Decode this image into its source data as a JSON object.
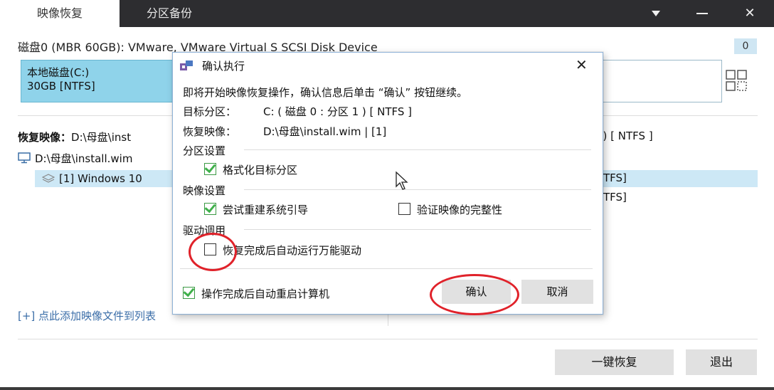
{
  "titlebar": {
    "tabs": [
      {
        "label": "映像恢复",
        "active": true
      },
      {
        "label": "分区备份",
        "active": false
      }
    ],
    "close_symbol": "✕"
  },
  "main": {
    "disk_title": "磁盘0 (MBR 60GB): VMware, VMware Virtual S SCSI Disk Device",
    "disk_count": "0",
    "partition": {
      "name": "本地磁盘(C:)",
      "size": "30GB [NTFS]"
    },
    "restore_label": "恢复映像：",
    "restore_path": "D:\\母盘\\inst",
    "restore_target_partial": ". ) [ NTFS ]",
    "tree_item": "D:\\母盘\\install.wim",
    "tree_sub": "[1] Windows 10",
    "right_line1": "TFS]",
    "right_line2": "TFS]",
    "add_link": "[+] 点此添加映像文件到列表",
    "btn_restore": "一键恢复",
    "btn_exit": "退出"
  },
  "dialog": {
    "title": "确认执行",
    "close_symbol": "✕",
    "intro": "即将开始映像恢复操作，确认信息后单击 “确认” 按钮继续。",
    "target_label": "目标分区：",
    "target_value": "C: ( 磁盘 0 : 分区 1 ) [ NTFS ]",
    "image_label": "恢复映像：",
    "image_value": "D:\\母盘\\install.wim | [1]",
    "sections": {
      "partition": "分区设置",
      "image": "映像设置",
      "driver": "驱动调用"
    },
    "options": {
      "format": {
        "label": "格式化目标分区",
        "checked": true
      },
      "rebuild_boot": {
        "label": "尝试重建系统引导",
        "checked": true
      },
      "verify_image": {
        "label": "验证映像的完整性",
        "checked": false
      },
      "auto_driver": {
        "label": "恢复完成后自动运行万能驱动",
        "checked": false
      },
      "auto_restart": {
        "label": "操作完成后自动重启计算机",
        "checked": true
      }
    },
    "btn_ok": "确认",
    "btn_cancel": "取消"
  },
  "colors": {
    "titlebar": "#2d2d30",
    "partition_fill": "#8fd3ea",
    "selection": "#cde8f6",
    "check_green": "#3fb04a",
    "annotation_red": "#e0222a"
  }
}
